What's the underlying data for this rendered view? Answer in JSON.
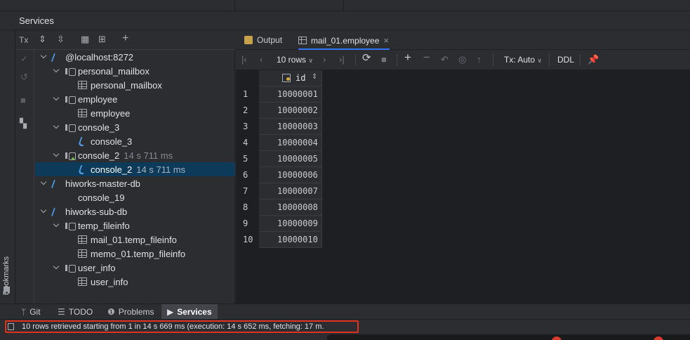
{
  "panel": {
    "title": "Services",
    "bookmarks_label": "Bookmarks"
  },
  "toolbar": {
    "tx_label": "Tx"
  },
  "tree": [
    {
      "label": "@localhost:8272",
      "icon": "connection-icon",
      "expanded": true,
      "time": ""
    },
    {
      "label": "personal_mailbox",
      "icon": "schema-icon",
      "expanded": true,
      "time": ""
    },
    {
      "label": "personal_mailbox",
      "icon": "table-icon",
      "time": ""
    },
    {
      "label": "employee",
      "icon": "schema-icon",
      "expanded": true,
      "time": ""
    },
    {
      "label": "employee",
      "icon": "table-icon",
      "time": ""
    },
    {
      "label": "console_3",
      "icon": "schema-icon",
      "expanded": true,
      "time": ""
    },
    {
      "label": "console_3",
      "icon": "console-icon",
      "time": ""
    },
    {
      "label": "console_2",
      "icon": "schema-icon",
      "expanded": true,
      "time": "14 s 711 ms"
    },
    {
      "label": "console_2",
      "icon": "console-icon",
      "time": "14 s 711 ms",
      "selected": true
    },
    {
      "label": "hiworks-master-db",
      "icon": "connection-icon",
      "expanded": true,
      "time": ""
    },
    {
      "label": "console_19",
      "icon": "",
      "time": ""
    },
    {
      "label": "hiworks-sub-db",
      "icon": "connection-icon",
      "expanded": true,
      "time": ""
    },
    {
      "label": "temp_fileinfo",
      "icon": "schema-icon",
      "expanded": true,
      "time": ""
    },
    {
      "label": "mail_01.temp_fileinfo",
      "icon": "table-icon",
      "time": ""
    },
    {
      "label": "memo_01.temp_fileinfo",
      "icon": "table-icon",
      "time": ""
    },
    {
      "label": "user_info",
      "icon": "schema-icon",
      "expanded": true,
      "time": ""
    },
    {
      "label": "user_info",
      "icon": "table-icon",
      "time": ""
    }
  ],
  "tabs": [
    {
      "label": "Output",
      "active": false
    },
    {
      "label": "mail_01.employee",
      "active": true,
      "close": "×"
    }
  ],
  "grid_toolbar": {
    "rows_label": "10 rows",
    "tx_label": "Tx: Auto",
    "ddl_label": "DDL"
  },
  "grid": {
    "column": "id",
    "rows": [
      {
        "num": "1",
        "id": "10000001"
      },
      {
        "num": "2",
        "id": "10000002"
      },
      {
        "num": "3",
        "id": "10000003"
      },
      {
        "num": "4",
        "id": "10000004"
      },
      {
        "num": "5",
        "id": "10000005"
      },
      {
        "num": "6",
        "id": "10000006"
      },
      {
        "num": "7",
        "id": "10000007"
      },
      {
        "num": "8",
        "id": "10000008"
      },
      {
        "num": "9",
        "id": "10000009"
      },
      {
        "num": "10",
        "id": "10000010"
      }
    ]
  },
  "bottom_tabs": [
    {
      "label": "Git",
      "icon": "git-branch-icon",
      "active": false
    },
    {
      "label": "TODO",
      "icon": "list-icon",
      "active": false
    },
    {
      "label": "Problems",
      "icon": "problems-icon",
      "active": false
    },
    {
      "label": "Services",
      "icon": "play-icon",
      "active": true
    }
  ],
  "status": {
    "message": "10 rows retrieved starting from 1 in 14 s 669 ms (execution: 14 s 652 ms, fetching: 17 m."
  },
  "colors": {
    "accent": "#3574f0",
    "selection": "#0d3a58",
    "highlight_box": "#e0321c",
    "connection": "#4f9de8"
  }
}
